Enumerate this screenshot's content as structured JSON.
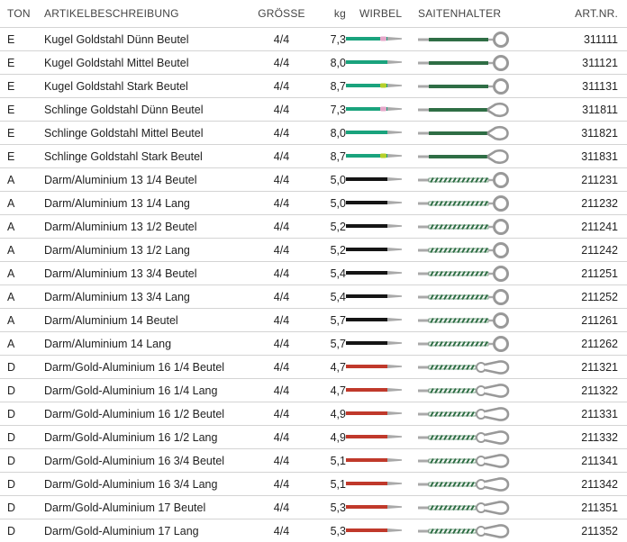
{
  "headers": {
    "ton": "TON",
    "desc": "ARTIKELBESCHREIBUNG",
    "size": "GRÖSSE",
    "kg": "kg",
    "wirbel": "WIRBEL",
    "saitenhalter": "SAITENHALTER",
    "art": "ART.NR."
  },
  "colors": {
    "teal": "#1aa37d",
    "black": "#151515",
    "red": "#c0392b",
    "pink": "#e6a6c9",
    "lime": "#b5cf2a",
    "tail_green": "#2f6e45",
    "steel": "#a9a9a9"
  },
  "rows": [
    {
      "ton": "E",
      "desc": "Kugel Goldstahl Dünn Beutel",
      "size": "4/4",
      "kg": "7,3",
      "art": "311111",
      "wirbel": "teal",
      "marker": "pink",
      "tail": "ball"
    },
    {
      "ton": "E",
      "desc": "Kugel Goldstahl Mittel Beutel",
      "size": "4/4",
      "kg": "8,0",
      "art": "311121",
      "wirbel": "teal",
      "marker": "none",
      "tail": "ball"
    },
    {
      "ton": "E",
      "desc": "Kugel Goldstahl Stark Beutel",
      "size": "4/4",
      "kg": "8,7",
      "art": "311131",
      "wirbel": "teal",
      "marker": "lime",
      "tail": "ball"
    },
    {
      "ton": "E",
      "desc": "Schlinge Goldstahl Dünn Beutel",
      "size": "4/4",
      "kg": "7,3",
      "art": "311811",
      "wirbel": "teal",
      "marker": "pink",
      "tail": "loop"
    },
    {
      "ton": "E",
      "desc": "Schlinge Goldstahl Mittel Beutel",
      "size": "4/4",
      "kg": "8,0",
      "art": "311821",
      "wirbel": "teal",
      "marker": "none",
      "tail": "loop"
    },
    {
      "ton": "E",
      "desc": "Schlinge Goldstahl Stark Beutel",
      "size": "4/4",
      "kg": "8,7",
      "art": "311831",
      "wirbel": "teal",
      "marker": "lime",
      "tail": "loop"
    },
    {
      "ton": "A",
      "desc": "Darm/Aluminium 13 1/4 Beutel",
      "size": "4/4",
      "kg": "5,0",
      "art": "211231",
      "wirbel": "black",
      "marker": "none",
      "tail": "wound-ball"
    },
    {
      "ton": "A",
      "desc": "Darm/Aluminium 13 1/4 Lang",
      "size": "4/4",
      "kg": "5,0",
      "art": "211232",
      "wirbel": "black",
      "marker": "none",
      "tail": "wound-ball"
    },
    {
      "ton": "A",
      "desc": "Darm/Aluminium 13 1/2 Beutel",
      "size": "4/4",
      "kg": "5,2",
      "art": "211241",
      "wirbel": "black",
      "marker": "none",
      "tail": "wound-ball"
    },
    {
      "ton": "A",
      "desc": "Darm/Aluminium 13 1/2 Lang",
      "size": "4/4",
      "kg": "5,2",
      "art": "211242",
      "wirbel": "black",
      "marker": "none",
      "tail": "wound-ball"
    },
    {
      "ton": "A",
      "desc": "Darm/Aluminium 13 3/4 Beutel",
      "size": "4/4",
      "kg": "5,4",
      "art": "211251",
      "wirbel": "black",
      "marker": "none",
      "tail": "wound-ball"
    },
    {
      "ton": "A",
      "desc": "Darm/Aluminium 13 3/4 Lang",
      "size": "4/4",
      "kg": "5,4",
      "art": "211252",
      "wirbel": "black",
      "marker": "none",
      "tail": "wound-ball"
    },
    {
      "ton": "A",
      "desc": "Darm/Aluminium 14 Beutel",
      "size": "4/4",
      "kg": "5,7",
      "art": "211261",
      "wirbel": "black",
      "marker": "none",
      "tail": "wound-ball"
    },
    {
      "ton": "A",
      "desc": "Darm/Aluminium 14 Lang",
      "size": "4/4",
      "kg": "5,7",
      "art": "211262",
      "wirbel": "black",
      "marker": "none",
      "tail": "wound-ball"
    },
    {
      "ton": "D",
      "desc": "Darm/Gold-Aluminium 16 1/4 Beutel",
      "size": "4/4",
      "kg": "4,7",
      "art": "211321",
      "wirbel": "red",
      "marker": "none",
      "tail": "wound-knot"
    },
    {
      "ton": "D",
      "desc": "Darm/Gold-Aluminium 16 1/4 Lang",
      "size": "4/4",
      "kg": "4,7",
      "art": "211322",
      "wirbel": "red",
      "marker": "none",
      "tail": "wound-knot"
    },
    {
      "ton": "D",
      "desc": "Darm/Gold-Aluminium 16 1/2 Beutel",
      "size": "4/4",
      "kg": "4,9",
      "art": "211331",
      "wirbel": "red",
      "marker": "none",
      "tail": "wound-knot"
    },
    {
      "ton": "D",
      "desc": "Darm/Gold-Aluminium 16 1/2 Lang",
      "size": "4/4",
      "kg": "4,9",
      "art": "211332",
      "wirbel": "red",
      "marker": "none",
      "tail": "wound-knot"
    },
    {
      "ton": "D",
      "desc": "Darm/Gold-Aluminium 16 3/4 Beutel",
      "size": "4/4",
      "kg": "5,1",
      "art": "211341",
      "wirbel": "red",
      "marker": "none",
      "tail": "wound-knot"
    },
    {
      "ton": "D",
      "desc": "Darm/Gold-Aluminium 16 3/4 Lang",
      "size": "4/4",
      "kg": "5,1",
      "art": "211342",
      "wirbel": "red",
      "marker": "none",
      "tail": "wound-knot"
    },
    {
      "ton": "D",
      "desc": "Darm/Gold-Aluminium 17 Beutel",
      "size": "4/4",
      "kg": "5,3",
      "art": "211351",
      "wirbel": "red",
      "marker": "none",
      "tail": "wound-knot"
    },
    {
      "ton": "D",
      "desc": "Darm/Gold-Aluminium 17 Lang",
      "size": "4/4",
      "kg": "5,3",
      "art": "211352",
      "wirbel": "red",
      "marker": "none",
      "tail": "wound-knot"
    }
  ]
}
